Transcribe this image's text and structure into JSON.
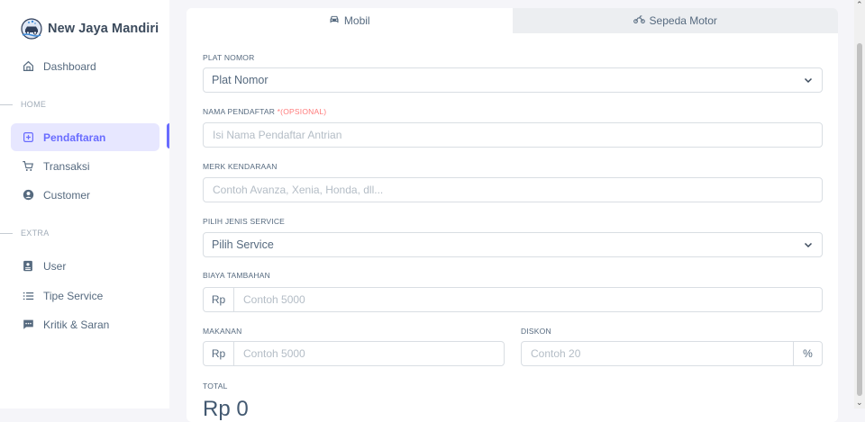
{
  "brand": {
    "name": "New Jaya Mandiri",
    "logo_icon": "car-wash-logo"
  },
  "sidebar": {
    "dashboard": {
      "label": "Dashboard",
      "icon": "home-icon"
    },
    "section_home": "HOME",
    "items_home": [
      {
        "label": "Pendaftaran",
        "icon": "plus-square-icon",
        "active": true
      },
      {
        "label": "Transaksi",
        "icon": "cart-icon"
      },
      {
        "label": "Customer",
        "icon": "user-circle-icon"
      }
    ],
    "section_extra": "EXTRA",
    "items_extra": [
      {
        "label": "User",
        "icon": "id-card-icon"
      },
      {
        "label": "Tipe Service",
        "icon": "list-icon"
      },
      {
        "label": "Kritik & Saran",
        "icon": "chat-icon"
      }
    ]
  },
  "tabs": [
    {
      "label": "Mobil",
      "icon": "car-icon",
      "active": true
    },
    {
      "label": "Sepeda Motor",
      "icon": "motorcycle-icon",
      "active": false
    }
  ],
  "form": {
    "plat_nomor": {
      "label": "PLAT NOMOR",
      "value": "Plat Nomor"
    },
    "nama_pendaftar": {
      "label": "NAMA PENDAFTAR ",
      "optional": "*(OPSIONAL)",
      "placeholder": "Isi Nama Pendaftar Antrian"
    },
    "merk_kendaraan": {
      "label": "MERK KENDARAAN",
      "placeholder": "Contoh Avanza, Xenia, Honda, dll..."
    },
    "jenis_service": {
      "label": "PILIH JENIS SERVICE",
      "value": "Pilih Service"
    },
    "biaya_tambahan": {
      "label": "BIAYA TAMBAHAN",
      "prefix": "Rp",
      "placeholder": "Contoh 5000"
    },
    "makanan": {
      "label": "MAKANAN",
      "prefix": "Rp",
      "placeholder": "Contoh 5000"
    },
    "diskon": {
      "label": "DISKON",
      "placeholder": "Contoh 20",
      "suffix": "%"
    },
    "total": {
      "label": "TOTAL",
      "value": "Rp 0"
    }
  },
  "colors": {
    "accent": "#696cff",
    "accent_bg": "#e7e7ff",
    "text": "#566a7f"
  }
}
